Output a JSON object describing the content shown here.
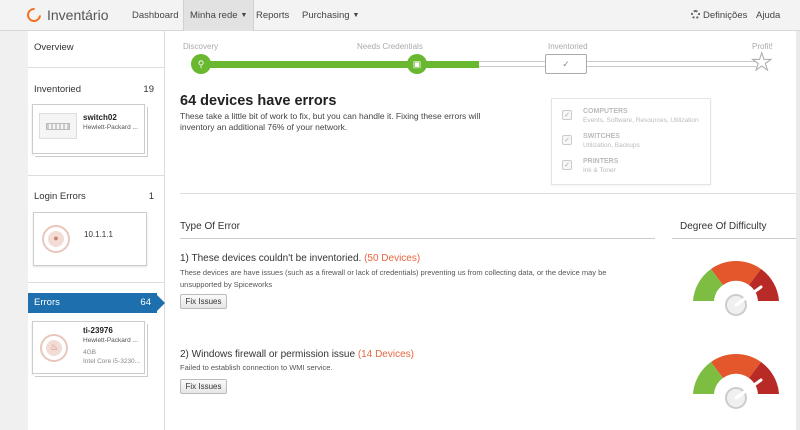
{
  "brand": {
    "name": "Inventário"
  },
  "nav": {
    "dashboard": "Dashboard",
    "minha_rede": "Minha rede",
    "reports": "Reports",
    "purchasing": "Purchasing",
    "settings": "Definições",
    "help": "Ajuda"
  },
  "sidebar": {
    "overview": "Overview",
    "inventoried": {
      "label": "Inventoried",
      "count": "19"
    },
    "inventoried_card": {
      "name": "switch02",
      "vendor": "Hewlett-Packard ..."
    },
    "login_errors": {
      "label": "Login Errors",
      "count": "1"
    },
    "login_card": {
      "ip": "10.1.1.1"
    },
    "errors": {
      "label": "Errors",
      "count": "64"
    },
    "errors_card": {
      "name": "ti-23976",
      "vendor": "Hewlett-Packard ...",
      "memory": "4GB",
      "cpu": "Intel Core i5-3230..."
    }
  },
  "progress": {
    "steps": [
      "Discovery",
      "Needs Credentials",
      "Inventoried",
      "Profit!"
    ]
  },
  "summary": {
    "headline": "64 devices have errors",
    "text": "These take a little bit of work to fix, but you can handle it. Fixing these errors will inventory an additional 76% of your network."
  },
  "checklist": [
    {
      "title": "COMPUTERS",
      "sub": "Events, Software, Resources, Utilization"
    },
    {
      "title": "SWITCHES",
      "sub": "Utilization, Backups"
    },
    {
      "title": "PRINTERS",
      "sub": "Ink & Toner"
    }
  ],
  "table": {
    "col_error": "Type Of Error",
    "col_difficulty": "Degree Of Difficulty"
  },
  "errors": [
    {
      "title": "1) These devices couldn't be inventoried.",
      "count": "(50 Devices)",
      "desc": "These devices are have issues (such as a firewall or lack of credentials) preventing us from collecting data, or the device may be unsupported by Spiceworks",
      "button": "Fix Issues",
      "difficulty": "high"
    },
    {
      "title": "2) Windows firewall or permission issue",
      "count": "(14 Devices)",
      "desc": "Failed to establish connection to WMI service.",
      "button": "Fix Issues",
      "difficulty": "high"
    }
  ],
  "colors": {
    "accent": "#f37021",
    "progress": "#69b82f",
    "selected": "#1e6fae",
    "error_count": "#e8653f",
    "gauge_green": "#7dbd42",
    "gauge_orange": "#e4562b",
    "gauge_red": "#b72a26"
  }
}
